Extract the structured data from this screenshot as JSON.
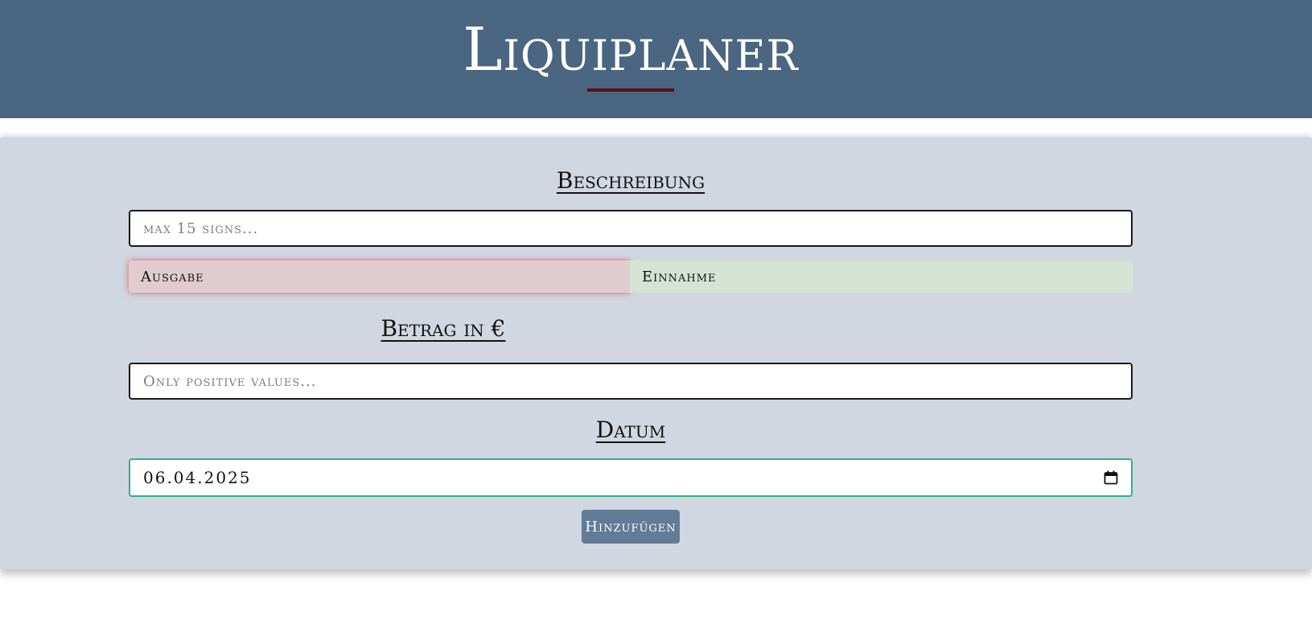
{
  "header": {
    "title": "Liquiplaner",
    "background_color": "#4a6681",
    "underline_color": "#5a0f12"
  },
  "form": {
    "background_color": "#d0d7e1",
    "description": {
      "label": "Beschreibung",
      "placeholder": "max 15 signs...",
      "value": ""
    },
    "type_toggle": {
      "options": [
        {
          "label": "Ausgabe",
          "selected": true,
          "color": "#e0cccf"
        },
        {
          "label": "Einnahme",
          "selected": false,
          "color": "#d5e3d4"
        }
      ]
    },
    "amount": {
      "label": "Betrag in €",
      "placeholder": "Only positive values...",
      "value": ""
    },
    "date": {
      "label": "Datum",
      "value": "06.04.2025",
      "icon": "calendar-icon"
    },
    "submit": {
      "label": "Hinzufügen",
      "color": "#627b96"
    }
  }
}
